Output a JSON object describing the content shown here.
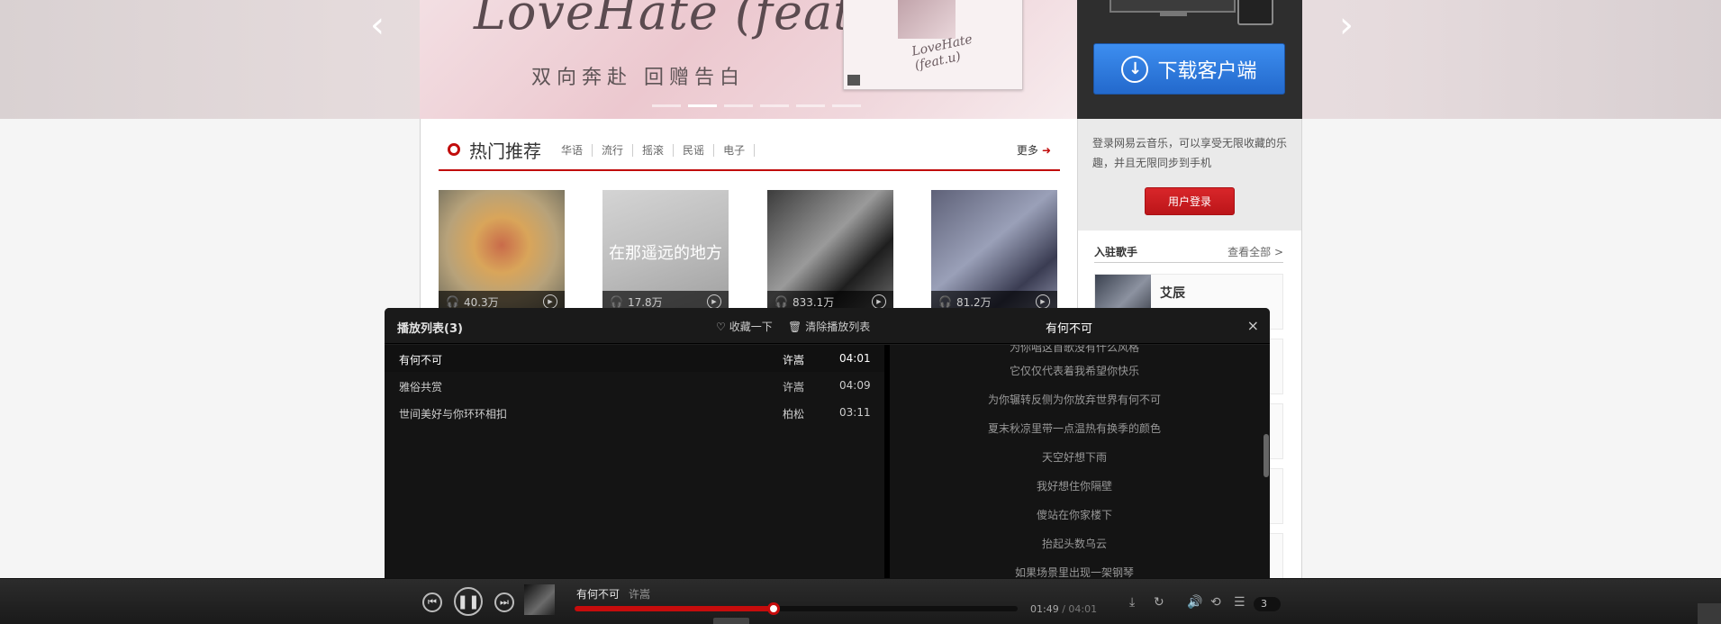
{
  "banner": {
    "script_text": "LoveHate (feat.u)",
    "subtitle": "双向奔赴  回赠告白",
    "cover_script": "LoveHate (feat.u)",
    "prev_arrow": "‹",
    "next_arrow": "›"
  },
  "sidebar": {
    "download_label": "下载客户端",
    "login_text": "登录网易云音乐，可以享受无限收藏的乐趣，并且无限同步到手机",
    "login_button": "用户登录",
    "singers_title": "入驻歌手",
    "singers_more": "查看全部 >",
    "singer_name": "艾辰"
  },
  "hot": {
    "title": "热门推荐",
    "tabs": [
      "华语",
      "流行",
      "摇滚",
      "民谣",
      "电子"
    ],
    "more": "更多",
    "covers": [
      {
        "plays": "40.3万"
      },
      {
        "plays": "17.8万",
        "overlay": "在那遥远的地方"
      },
      {
        "plays": "833.1万"
      },
      {
        "plays": "81.2万"
      }
    ]
  },
  "playlist": {
    "title": "播放列表(3)",
    "fav": "收藏一下",
    "clear": "清除播放列表",
    "lyric_title": "有何不可",
    "close": "×",
    "songs": [
      {
        "name": "有何不可",
        "artist": "许嵩",
        "duration": "04:01"
      },
      {
        "name": "雅俗共赏",
        "artist": "许嵩",
        "duration": "04:09"
      },
      {
        "name": "世间美好与你环环相扣",
        "artist": "柏松",
        "duration": "03:11"
      }
    ],
    "lyrics": [
      "为你唱这首歌没有什么风格",
      "它仅仅代表着我希望你快乐",
      "为你辗转反侧为你放弃世界有何不可",
      "夏末秋凉里带一点温热有换季的颜色",
      "天空好想下雨",
      "我好想住你隔壁",
      "傻站在你家楼下",
      "抬起头数乌云",
      "如果场景里出现一架钢琴"
    ]
  },
  "player": {
    "title": "有何不可",
    "artist": "许嵩",
    "current": "01:49",
    "total": "/ 04:01",
    "progress": 0.45,
    "count": "3"
  },
  "colors": {
    "accent": "#c10d0c",
    "download_blue": "#2f7ee0"
  }
}
